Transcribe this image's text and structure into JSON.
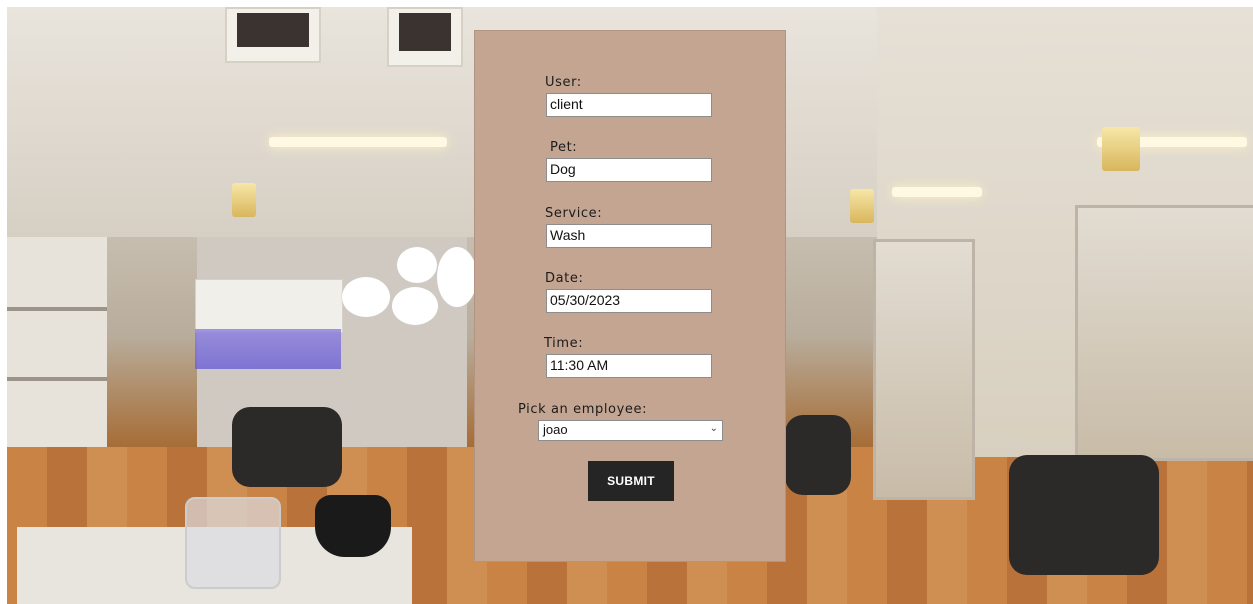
{
  "form": {
    "user": {
      "label": "User:",
      "value": "client"
    },
    "pet": {
      "label": "Pet:",
      "value": "Dog"
    },
    "service": {
      "label": "Service:",
      "value": "Wash"
    },
    "date": {
      "label": "Date:",
      "value": "05/30/2023"
    },
    "time": {
      "label": "Time:",
      "value": "11:30 AM"
    },
    "employee": {
      "label": "Pick an employee:",
      "selected": "joao"
    },
    "submit_label": "SUBMIT"
  },
  "colors": {
    "panel": "#c4a592",
    "button": "#252525"
  },
  "icons": {
    "select": "chevron-down-icon"
  }
}
